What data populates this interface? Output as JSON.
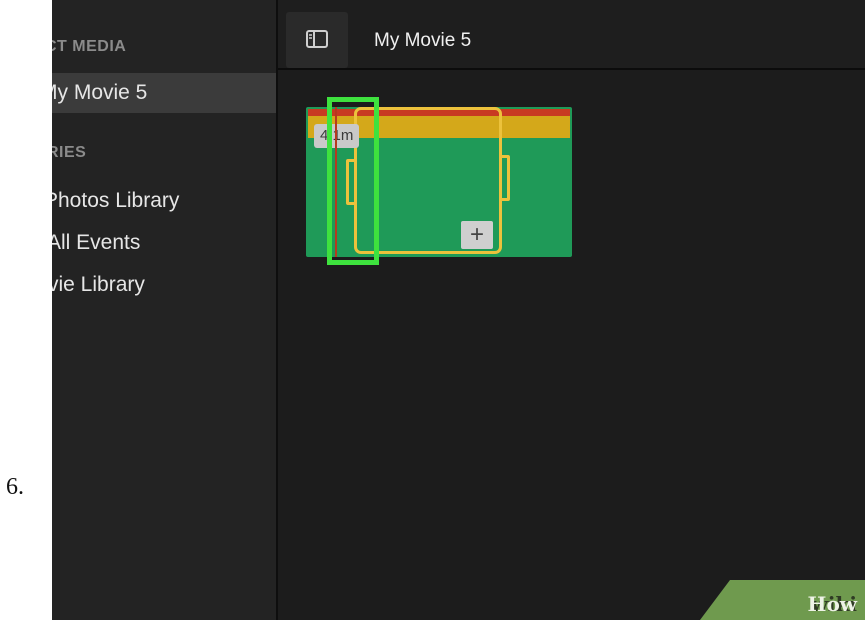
{
  "step": {
    "number": "6."
  },
  "sidebar": {
    "sections": [
      {
        "header": "CT MEDIA",
        "items": [
          {
            "label": "My Movie 5",
            "selected": true
          }
        ]
      },
      {
        "header": "RIES",
        "items": [
          {
            "label": "Photos Library"
          },
          {
            "label": "All Events"
          },
          {
            "label": "vie Library"
          }
        ]
      }
    ]
  },
  "toolbar": {
    "toggle_icon": "sidebar-toggle-icon",
    "project_title": "My Movie 5"
  },
  "clip": {
    "duration": "4.1m",
    "add_label": "+"
  },
  "watermark": {
    "part1": "wiki",
    "part2": "How"
  },
  "colors": {
    "highlight": "#3ee23e",
    "clip_green": "#1f9a58",
    "selection_yellow": "#ecc23c"
  }
}
